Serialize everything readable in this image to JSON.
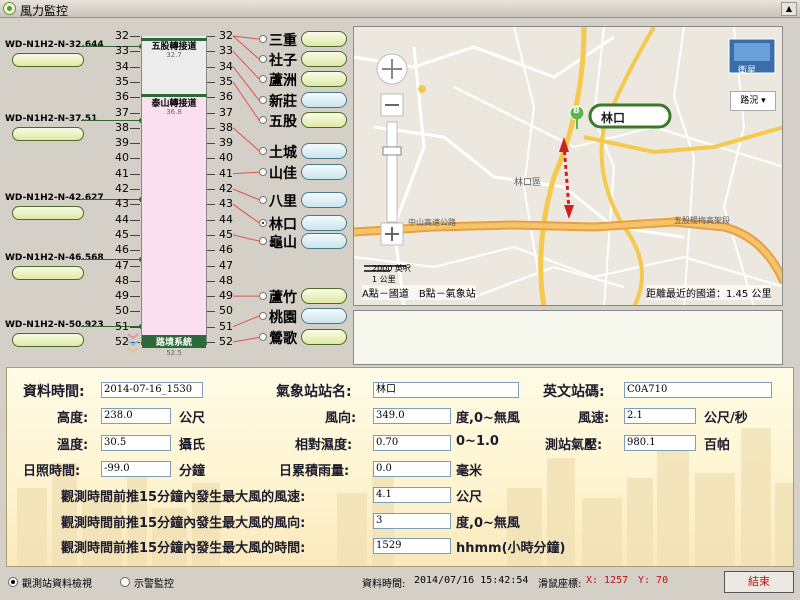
{
  "window": {
    "title": "風力監控",
    "ctrl_glyph": "▲"
  },
  "wind_sensors": [
    {
      "label": "WD-N1H2-N-32.644",
      "km": 32.644
    },
    {
      "label": "WD-N1H2-N-37.51",
      "km": 37.51
    },
    {
      "label": "WD-N1H2-N-42.627",
      "km": 42.627
    },
    {
      "label": "WD-N1H2-N-46.568",
      "km": 46.568
    },
    {
      "label": "WD-N1H2-N-50.923",
      "km": 50.923
    }
  ],
  "mileage": {
    "left": [
      "32",
      "33",
      "34",
      "35",
      "36",
      "37",
      "38",
      "39",
      "40",
      "41",
      "42",
      "43",
      "44",
      "45",
      "46",
      "47",
      "48",
      "49",
      "50",
      "51",
      "52"
    ],
    "right": [
      "32",
      "33",
      "34",
      "35",
      "36",
      "37",
      "38",
      "39",
      "40",
      "41",
      "42",
      "43",
      "44",
      "45",
      "46",
      "47",
      "48",
      "49",
      "50",
      "51",
      "52"
    ]
  },
  "tower": {
    "top_label": "五股轉接道",
    "top_num": "32.7",
    "mid_label": "泰山轉接道",
    "mid_num": "36.8",
    "bottom_label": "路境系統",
    "bottom_num": "52.5"
  },
  "stations": [
    {
      "name": "三重",
      "km": 32.2,
      "color": "g",
      "selected": false
    },
    {
      "name": "社子",
      "km": 33.5,
      "color": "g",
      "selected": false
    },
    {
      "name": "蘆洲",
      "km": 34.8,
      "color": "g",
      "selected": false
    },
    {
      "name": "新莊",
      "km": 36.2,
      "color": "b",
      "selected": false
    },
    {
      "name": "五股",
      "km": 37.5,
      "color": "g",
      "selected": false
    },
    {
      "name": "土城",
      "km": 39.5,
      "color": "b",
      "selected": false
    },
    {
      "name": "山佳",
      "km": 40.9,
      "color": "b",
      "selected": false
    },
    {
      "name": "八里",
      "km": 42.7,
      "color": "b",
      "selected": false
    },
    {
      "name": "林口",
      "km": 44.2,
      "color": "b",
      "selected": true
    },
    {
      "name": "龜山",
      "km": 45.4,
      "color": "b",
      "selected": false
    },
    {
      "name": "蘆竹",
      "km": 49.0,
      "color": "g",
      "selected": false
    },
    {
      "name": "桃園",
      "km": 50.3,
      "color": "b",
      "selected": false
    },
    {
      "name": "鶯歌",
      "km": 51.7,
      "color": "g",
      "selected": false
    }
  ],
  "station_links": [
    {
      "station": "三重",
      "km": 32
    },
    {
      "station": "社子",
      "km": 32
    },
    {
      "station": "蘆洲",
      "km": 33
    },
    {
      "station": "新莊",
      "km": 34
    },
    {
      "station": "五股",
      "km": 35
    },
    {
      "station": "土城",
      "km": 38
    },
    {
      "station": "山佳",
      "km": 41
    },
    {
      "station": "八里",
      "km": 42
    },
    {
      "station": "林口",
      "km": 43
    },
    {
      "station": "龜山",
      "km": 45
    },
    {
      "station": "蘆竹",
      "km": 49
    },
    {
      "station": "桃園",
      "km": 51
    },
    {
      "station": "鶯歌",
      "km": 52
    }
  ],
  "map": {
    "callout": "林口",
    "marker_a": "A",
    "marker_b": "B",
    "layer_satellite": "衛星",
    "layer_road": "路況",
    "legend": "A點－國道　B點－氣象站",
    "distance": "距離最近的國道：1.45 公里",
    "scale_top": "2000 英呎",
    "scale_bottom": "1 公里",
    "expressway_1": "中山高速公路",
    "expressway_2": "五股楊梅高架段",
    "district": "林口區"
  },
  "detail": {
    "data_time_label": "資料時間:",
    "data_time": "2014-07-16_1530",
    "station_name_label": "氣象站站名:",
    "station_name": "林口",
    "eng_code_label": "英文站碼:",
    "eng_code": "C0A710",
    "height_label": "高度:",
    "height": "238.0",
    "height_unit": "公尺",
    "wind_dir_label": "風向:",
    "wind_dir": "349.0",
    "wind_dir_unit": "度,0~無風",
    "wind_speed_label": "風速:",
    "wind_speed": "2.1",
    "wind_speed_unit": "公尺/秒",
    "temp_label": "溫度:",
    "temp": "30.5",
    "temp_unit": "攝氏",
    "humidity_label": "相對濕度:",
    "humidity": "0.70",
    "humidity_unit": "0~1.0",
    "pressure_label": "測站氣壓:",
    "pressure": "980.1",
    "pressure_unit": "百帕",
    "sunshine_label": "日照時間:",
    "sunshine": "-99.0",
    "sunshine_unit": "分鐘",
    "rain_label": "日累積雨量:",
    "rain": "0.0",
    "rain_unit": "毫米",
    "max_speed_label": "觀測時間前推15分鐘內發生最大風的風速:",
    "max_speed": "4.1",
    "max_speed_unit": "公尺",
    "max_dir_label": "觀測時間前推15分鐘內發生最大風的風向:",
    "max_dir": "3",
    "max_dir_unit": "度,0~無風",
    "max_time_label": "觀測時間前推15分鐘內發生最大風的時間:",
    "max_time": "1529",
    "max_time_unit": "hhmm(小時分鐘)"
  },
  "status": {
    "mode1": "觀測站資料檢視",
    "mode2": "示警監控",
    "time_label": "資料時間:",
    "time_value": "2014/07/16 15:42:54",
    "mouse_label": "滑鼠座標:",
    "mouse_x": "X: 1257",
    "mouse_y": "Y: 70",
    "end_button": "結束"
  },
  "colors": {
    "station_green": "#dfe9a6",
    "station_blue": "#c9e5ec",
    "tower_pink": "#f9dff0",
    "link_red": "#e05050",
    "end_red": "#c01010",
    "callout_green": "#3a7a2a"
  }
}
